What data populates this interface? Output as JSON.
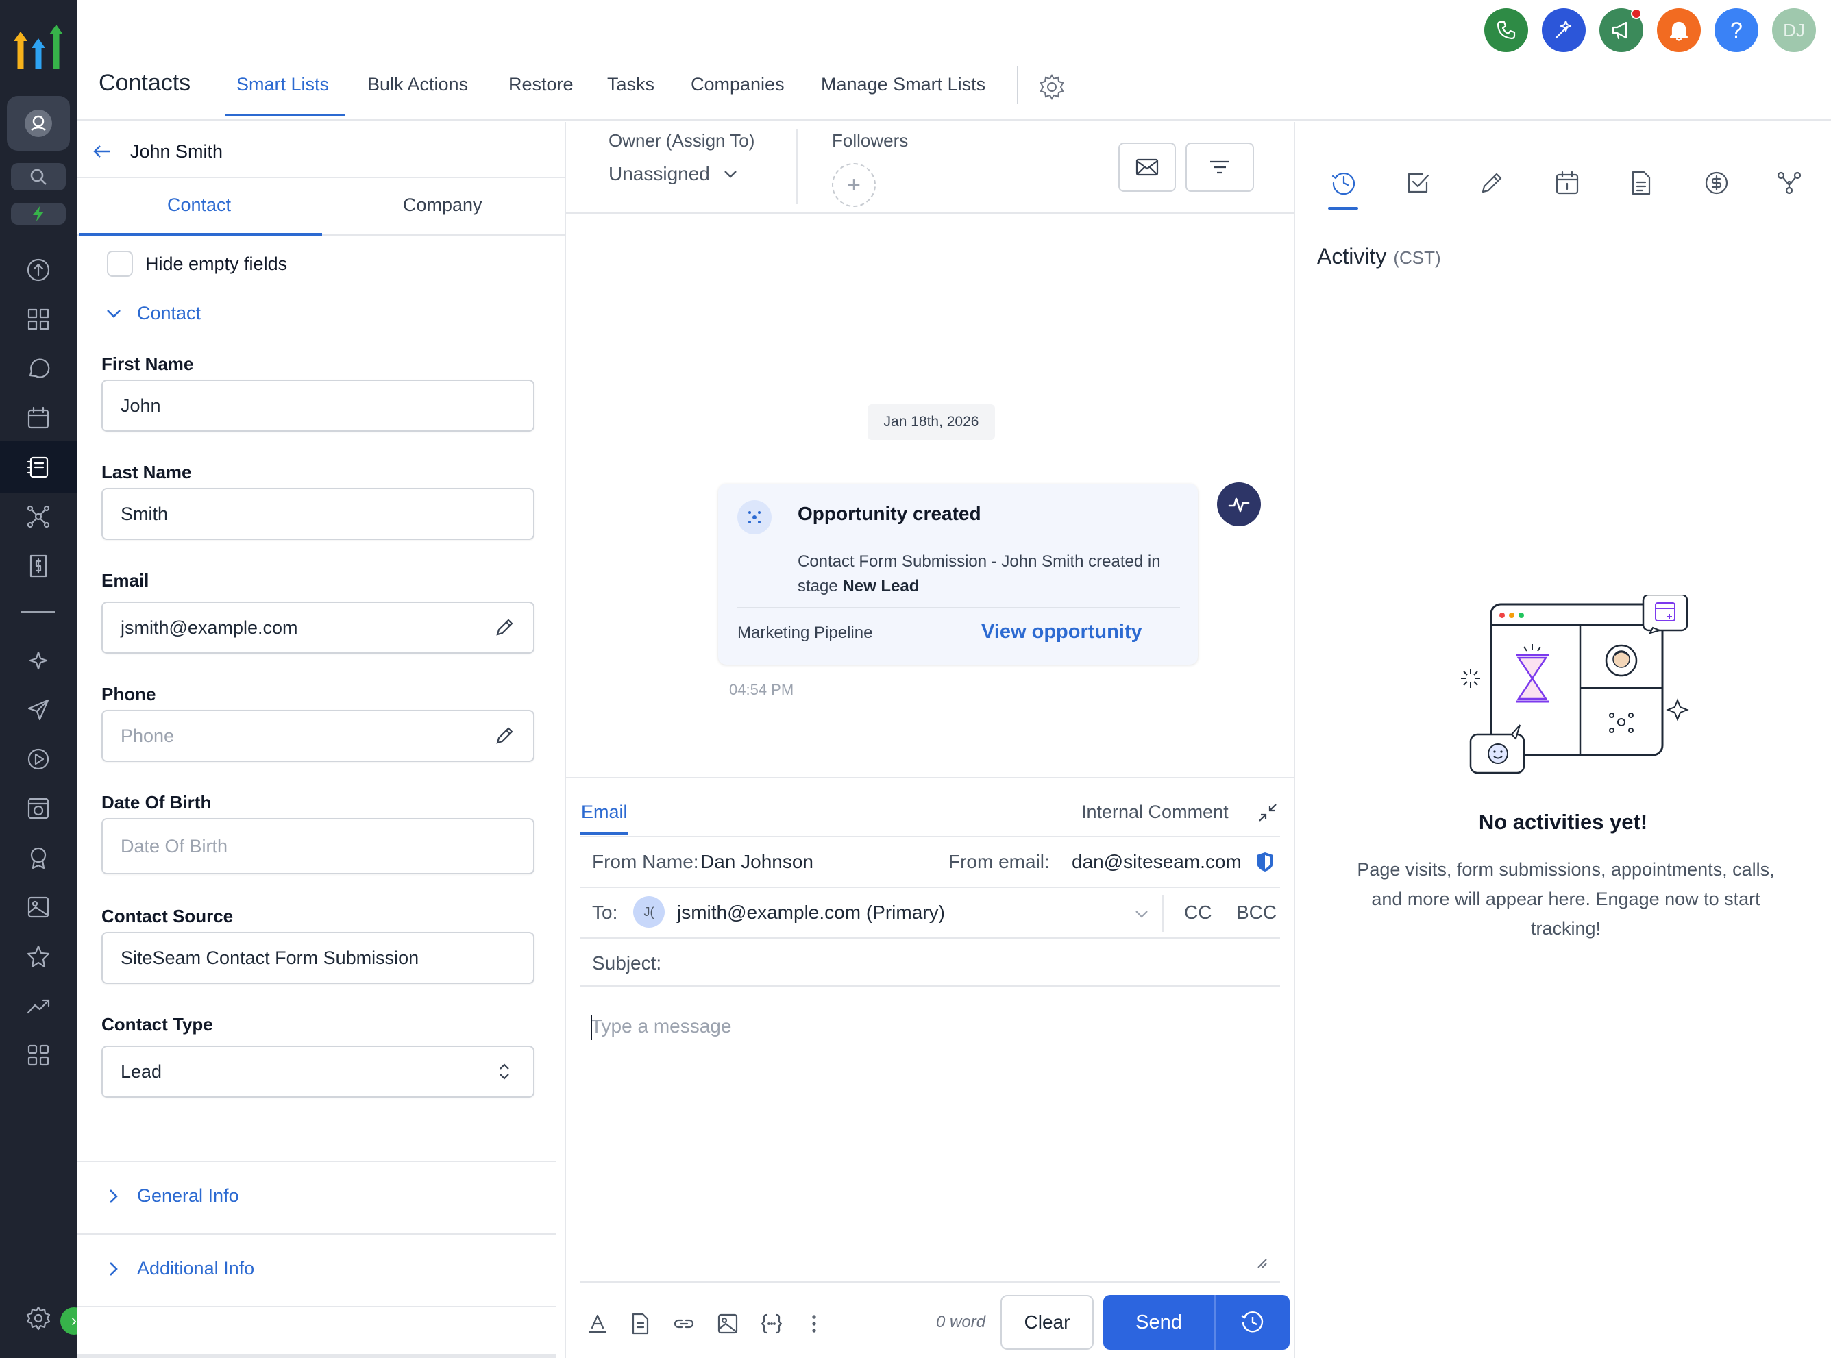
{
  "nav": {
    "title": "Contacts",
    "tabs": [
      "Smart Lists",
      "Bulk Actions",
      "Restore",
      "Tasks",
      "Companies",
      "Manage Smart Lists"
    ],
    "active_tab": "Smart Lists"
  },
  "top_icons": {
    "avatar_initials": "DJ",
    "help_label": "?",
    "colors": {
      "phone": "#2e8b45",
      "ai": "#2c56d9",
      "announce": "#3b8a5a",
      "bell": "#f26b21",
      "help": "#3a82f6",
      "avatar": "#9fc8ad"
    }
  },
  "contact": {
    "back_name": "John Smith",
    "subtabs": [
      "Contact",
      "Company"
    ],
    "hide_empty_label": "Hide empty fields",
    "section_title": "Contact",
    "fields": {
      "first_name_label": "First Name",
      "first_name": "John",
      "last_name_label": "Last Name",
      "last_name": "Smith",
      "email_label": "Email",
      "email": "jsmith@example.com",
      "phone_label": "Phone",
      "phone_placeholder": "Phone",
      "dob_label": "Date Of Birth",
      "dob_placeholder": "Date Of Birth",
      "source_label": "Contact Source",
      "source": "SiteSeam Contact Form Submission",
      "type_label": "Contact Type",
      "type": "Lead"
    },
    "collapsed_sections": [
      "General Info",
      "Additional Info"
    ]
  },
  "conversation": {
    "owner_label": "Owner (Assign To)",
    "owner_value": "Unassigned",
    "followers_label": "Followers",
    "date_chip": "Jan 18th, 2026",
    "opportunity": {
      "title": "Opportunity created",
      "desc_prefix": "Contact Form Submission - John Smith created in stage ",
      "stage": "New Lead",
      "pipeline": "Marketing Pipeline",
      "link": "View opportunity",
      "time": "04:54 PM"
    },
    "composer": {
      "tab_email": "Email",
      "tab_internal": "Internal Comment",
      "from_name_label": "From Name:",
      "from_name": "Dan Johnson",
      "from_email_label": "From email:",
      "from_email": "dan@siteseam.com",
      "to_label": "To:",
      "to_chip": "J(",
      "to_value": "jsmith@example.com (Primary)",
      "cc": "CC",
      "bcc": "BCC",
      "subject_label": "Subject:",
      "message_placeholder": "Type a message",
      "word_count": "0 word",
      "clear": "Clear",
      "send": "Send"
    }
  },
  "activity": {
    "title": "Activity",
    "tz": "(CST)",
    "empty_title": "No activities yet!",
    "empty_desc": "Page visits, form submissions, appointments, calls, and more will appear here. Engage now to start tracking!"
  }
}
